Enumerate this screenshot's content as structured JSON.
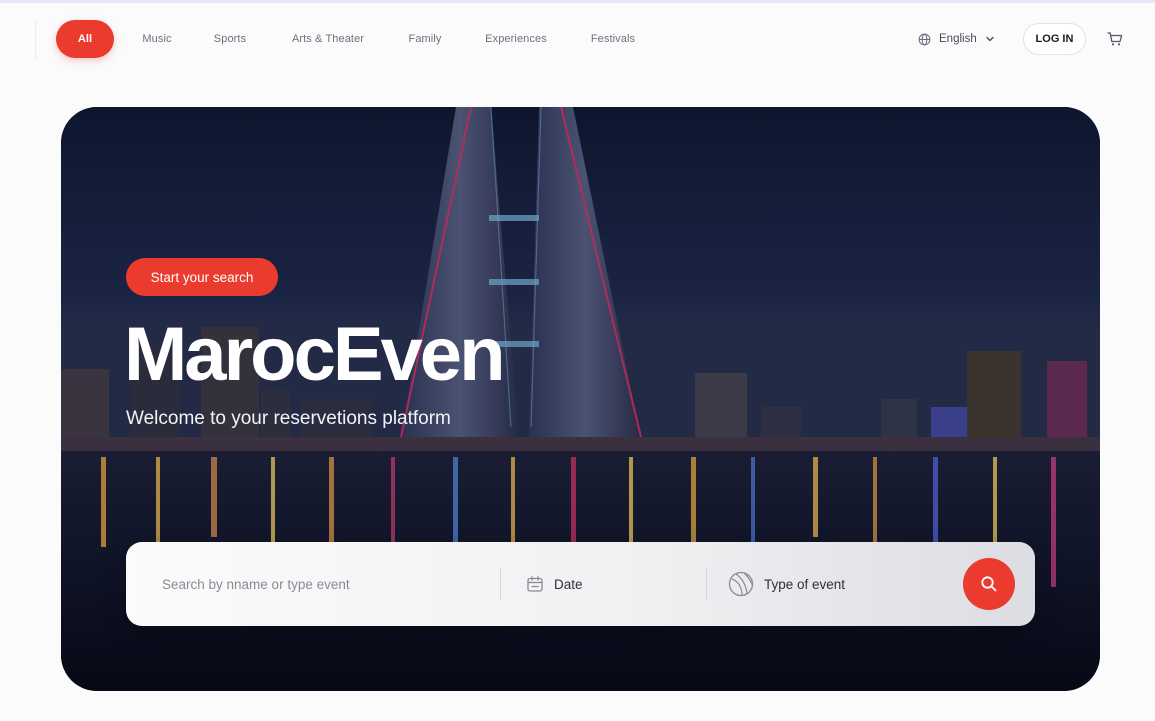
{
  "nav": {
    "categories": [
      {
        "label": "All",
        "active": true
      },
      {
        "label": "Music",
        "active": false
      },
      {
        "label": "Sports",
        "active": false
      },
      {
        "label": "Arts & Theater",
        "active": false
      },
      {
        "label": "Family",
        "active": false
      },
      {
        "label": "Experiences",
        "active": false
      },
      {
        "label": "Festivals",
        "active": false
      }
    ],
    "language": "English",
    "login_label": "LOG IN"
  },
  "hero": {
    "cta_label": "Start your search",
    "title": "MarocEven",
    "subtitle": "Welcome to your reservetions platform"
  },
  "search": {
    "placeholder": "Search by nname or type event",
    "date_label": "Date",
    "type_label": "Type of event"
  },
  "icons": {
    "language": "globe-icon",
    "language_dropdown": "chevron-down-icon",
    "cart": "cart-icon",
    "date": "calendar-icon",
    "type": "sports-ball-icon",
    "search": "search-icon"
  },
  "colors": {
    "accent": "#eb3b2f",
    "nav_text": "#6f6f80",
    "page_background": "#fbfbfc"
  }
}
